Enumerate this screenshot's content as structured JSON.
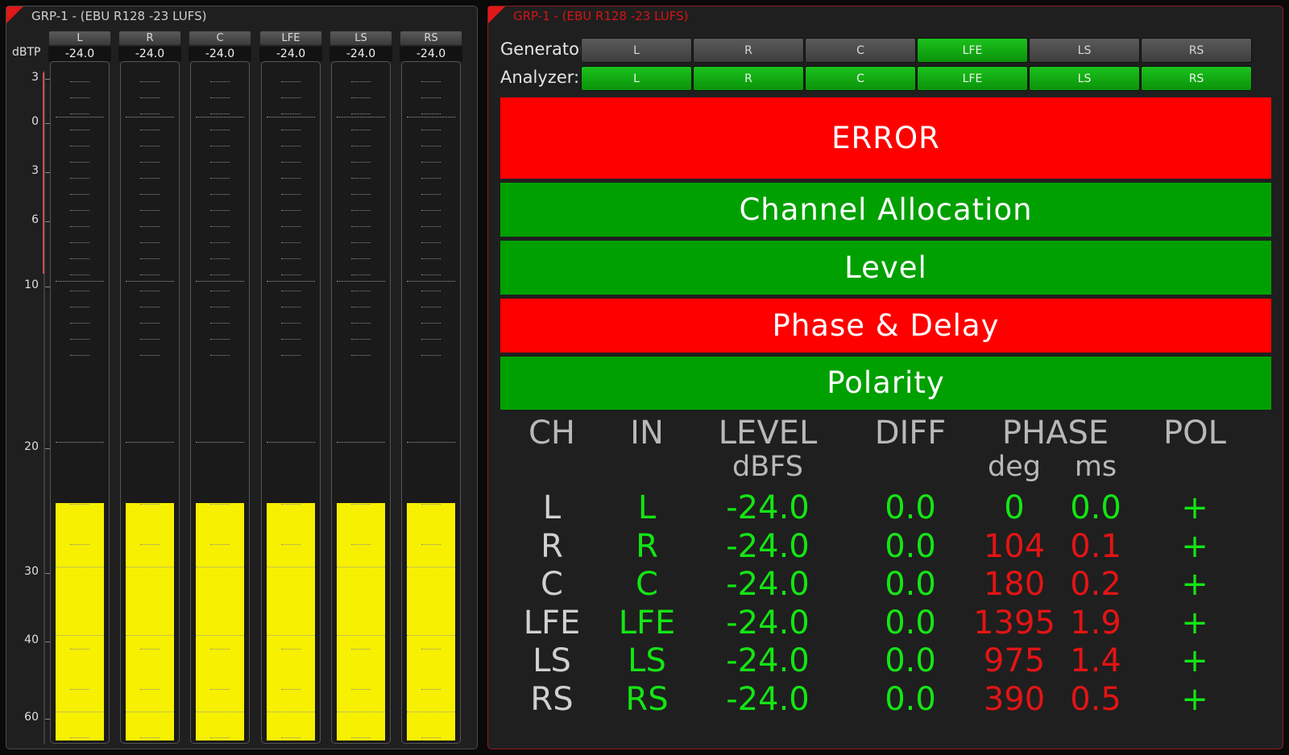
{
  "left_panel": {
    "title": "GRP-1 - (EBU R128 -23 LUFS)",
    "unit_label": "dBTP",
    "scale_labels": [
      "3",
      "0",
      "3",
      "6",
      "10",
      "20",
      "30",
      "40",
      "60"
    ],
    "channels": [
      {
        "name": "L",
        "value": "-24.0",
        "level_fraction": 0.35
      },
      {
        "name": "R",
        "value": "-24.0",
        "level_fraction": 0.35
      },
      {
        "name": "C",
        "value": "-24.0",
        "level_fraction": 0.35
      },
      {
        "name": "LFE",
        "value": "-24.0",
        "level_fraction": 0.35
      },
      {
        "name": "LS",
        "value": "-24.0",
        "level_fraction": 0.35
      },
      {
        "name": "RS",
        "value": "-24.0",
        "level_fraction": 0.35
      }
    ],
    "meter_color": "#f7f000"
  },
  "right_panel": {
    "title": "GRP-1 - (EBU R128 -23 LUFS)",
    "generator": {
      "label": "Generator:",
      "channels": [
        {
          "name": "L",
          "active": false
        },
        {
          "name": "R",
          "active": false
        },
        {
          "name": "C",
          "active": false
        },
        {
          "name": "LFE",
          "active": true
        },
        {
          "name": "LS",
          "active": false
        },
        {
          "name": "RS",
          "active": false
        }
      ]
    },
    "analyzer": {
      "label": "Analyzer:",
      "channels": [
        {
          "name": "L",
          "active": true
        },
        {
          "name": "R",
          "active": true
        },
        {
          "name": "C",
          "active": true
        },
        {
          "name": "LFE",
          "active": true
        },
        {
          "name": "LS",
          "active": true
        },
        {
          "name": "RS",
          "active": true
        }
      ]
    },
    "banners": [
      {
        "label": "ERROR",
        "status": "error"
      },
      {
        "label": "Channel Allocation",
        "status": "ok"
      },
      {
        "label": "Level",
        "status": "ok"
      },
      {
        "label": "Phase & Delay",
        "status": "error"
      },
      {
        "label": "Polarity",
        "status": "ok"
      }
    ],
    "table": {
      "headers": [
        "CH",
        "IN",
        "LEVEL",
        "DIFF",
        "PHASE",
        "POL"
      ],
      "subheaders": {
        "level": "dBFS",
        "phase_deg": "deg",
        "phase_ms": "ms"
      },
      "rows": [
        {
          "ch": "L",
          "in": "L",
          "level": "-24.0",
          "diff": "0.0",
          "deg": "0",
          "ms": "0.0",
          "pol": "+",
          "phase_ok": true
        },
        {
          "ch": "R",
          "in": "R",
          "level": "-24.0",
          "diff": "0.0",
          "deg": "104",
          "ms": "0.1",
          "pol": "+",
          "phase_ok": false
        },
        {
          "ch": "C",
          "in": "C",
          "level": "-24.0",
          "diff": "0.0",
          "deg": "180",
          "ms": "0.2",
          "pol": "+",
          "phase_ok": false
        },
        {
          "ch": "LFE",
          "in": "LFE",
          "level": "-24.0",
          "diff": "0.0",
          "deg": "1395",
          "ms": "1.9",
          "pol": "+",
          "phase_ok": false
        },
        {
          "ch": "LS",
          "in": "LS",
          "level": "-24.0",
          "diff": "0.0",
          "deg": "975",
          "ms": "1.4",
          "pol": "+",
          "phase_ok": false
        },
        {
          "ch": "RS",
          "in": "RS",
          "level": "-24.0",
          "diff": "0.0",
          "deg": "390",
          "ms": "0.5",
          "pol": "+",
          "phase_ok": false
        }
      ]
    },
    "colors": {
      "ok": "#00a000",
      "error": "#ff0000",
      "value_ok": "#14e514",
      "value_bad": "#e31414"
    }
  }
}
